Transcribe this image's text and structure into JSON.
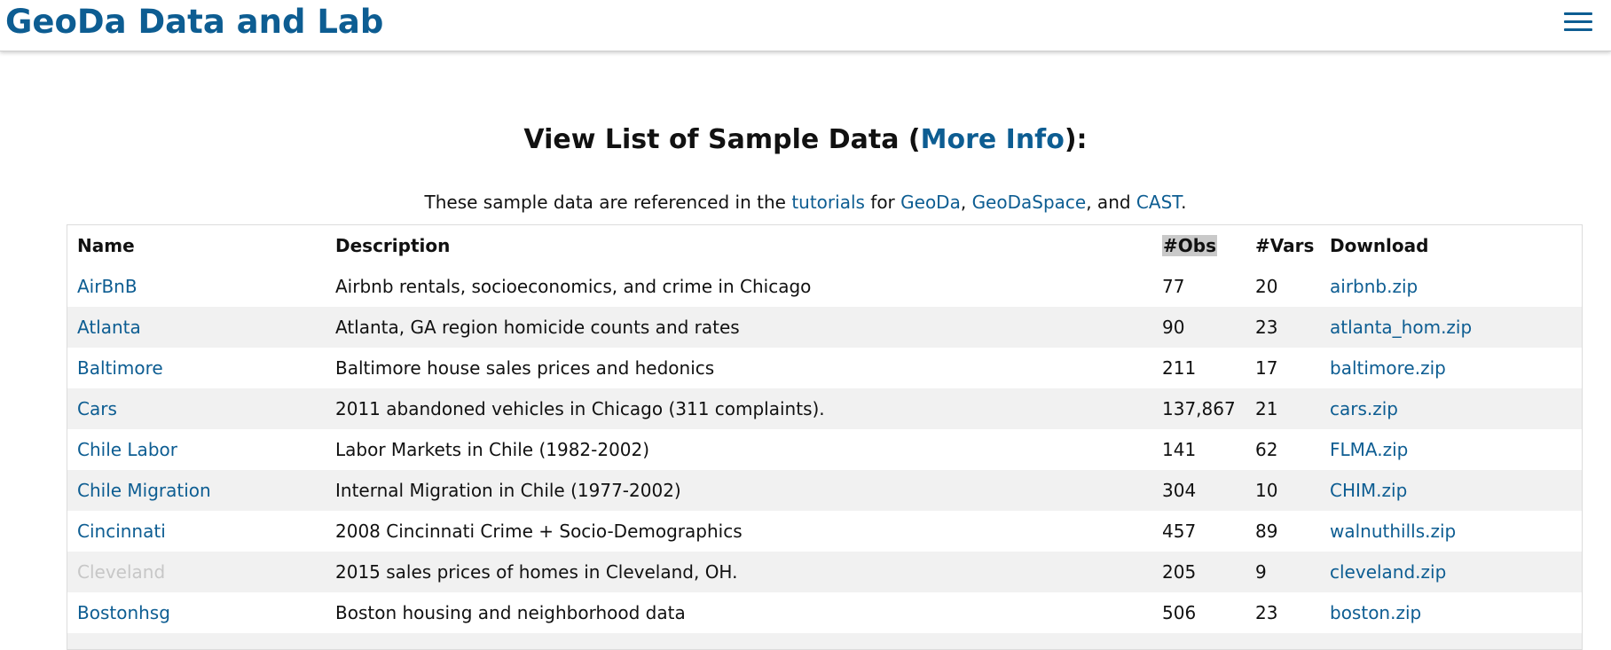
{
  "header": {
    "brand": "GeoDa Data and Lab",
    "menu_icon": "hamburger-icon"
  },
  "title": {
    "prefix": "View List of Sample Data (",
    "link": "More Info",
    "suffix": "):"
  },
  "subtitle": {
    "part1": "These sample data are referenced in the ",
    "tutorials": "tutorials",
    "part2": " for ",
    "geoda": "GeoDa",
    "sep1": ", ",
    "geodaspace": "GeoDaSpace",
    "sep2": ", and ",
    "cast": "CAST",
    "end": "."
  },
  "table": {
    "headers": {
      "name": "Name",
      "description": "Description",
      "obs": "#Obs",
      "vars": "#Vars",
      "download": "Download"
    },
    "rows": [
      {
        "name": "AirBnB",
        "description": "Airbnb rentals, socioeconomics, and crime in Chicago",
        "obs": "77",
        "vars": "20",
        "download": "airbnb.zip"
      },
      {
        "name": "Atlanta",
        "description": "Atlanta, GA region homicide counts and rates",
        "obs": "90",
        "vars": "23",
        "download": "atlanta_hom.zip"
      },
      {
        "name": "Baltimore",
        "description": "Baltimore house sales prices and hedonics",
        "obs": "211",
        "vars": "17",
        "download": "baltimore.zip"
      },
      {
        "name": "Cars",
        "description": "2011 abandoned vehicles in Chicago (311 complaints).",
        "obs": "137,867",
        "vars": "21",
        "download": "cars.zip"
      },
      {
        "name": "Chile Labor",
        "description": "Labor Markets in Chile (1982-2002)",
        "obs": "141",
        "vars": "62",
        "download": "FLMA.zip"
      },
      {
        "name": "Chile Migration",
        "description": "Internal Migration in Chile (1977-2002)",
        "obs": "304",
        "vars": "10",
        "download": "CHIM.zip"
      },
      {
        "name": "Cincinnati",
        "description": "2008 Cincinnati Crime + Socio-Demographics",
        "obs": "457",
        "vars": "89",
        "download": "walnuthills.zip"
      },
      {
        "name": "Cleveland",
        "description": "2015 sales prices of homes in Cleveland, OH.",
        "obs": "205",
        "vars": "9",
        "download": "cleveland.zip"
      },
      {
        "name": "Bostonhsg",
        "description": "Boston housing and neighborhood data",
        "obs": "506",
        "vars": "23",
        "download": "boston.zip"
      }
    ]
  },
  "colors": {
    "link": "#0d5d92",
    "row_stripe": "#f1f1f1",
    "disabled_link": "#c7c7c7"
  }
}
